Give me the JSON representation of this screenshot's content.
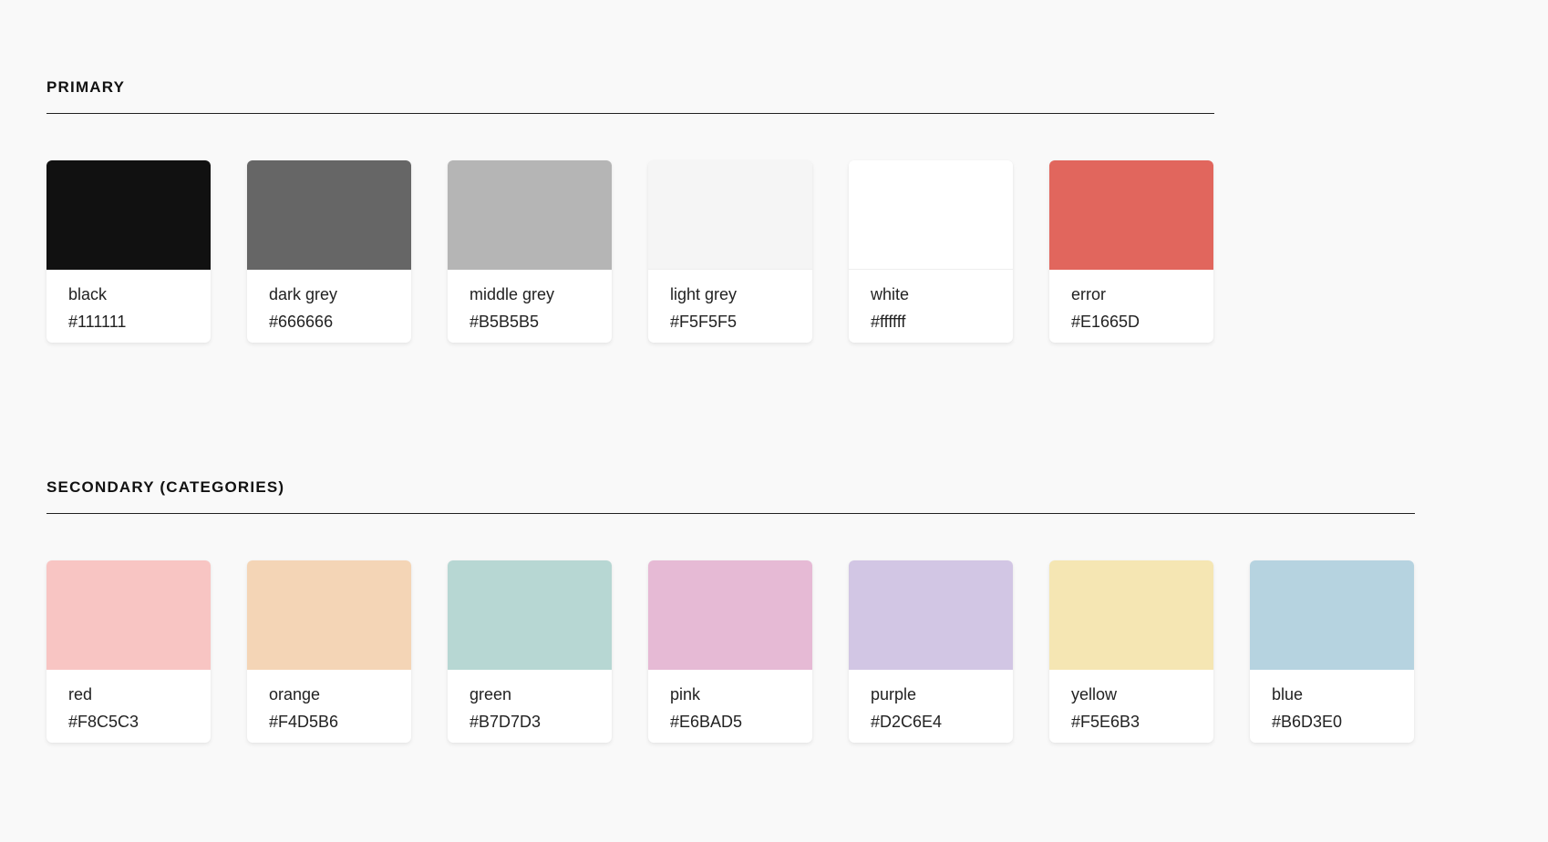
{
  "sections": [
    {
      "title": "PRIMARY",
      "swatches": [
        {
          "name": "black",
          "hex": "#111111",
          "color": "#111111"
        },
        {
          "name": "dark grey",
          "hex": "#666666",
          "color": "#666666"
        },
        {
          "name": "middle grey",
          "hex": "#B5B5B5",
          "color": "#B5B5B5"
        },
        {
          "name": "light grey",
          "hex": "#F5F5F5",
          "color": "#F5F5F5"
        },
        {
          "name": "white",
          "hex": "#ffffff",
          "color": "#ffffff"
        },
        {
          "name": "error",
          "hex": "#E1665D",
          "color": "#E1665D"
        }
      ]
    },
    {
      "title": "SECONDARY (CATEGORIES)",
      "swatches": [
        {
          "name": "red",
          "hex": "#F8C5C3",
          "color": "#F8C5C3"
        },
        {
          "name": "orange",
          "hex": "#F4D5B6",
          "color": "#F4D5B6"
        },
        {
          "name": "green",
          "hex": "#B7D7D3",
          "color": "#B7D7D3"
        },
        {
          "name": "pink",
          "hex": "#E6BAD5",
          "color": "#E6BAD5"
        },
        {
          "name": "purple",
          "hex": "#D2C6E4",
          "color": "#D2C6E4"
        },
        {
          "name": "yellow",
          "hex": "#F5E6B3",
          "color": "#F5E6B3"
        },
        {
          "name": "blue",
          "hex": "#B6D3E0",
          "color": "#B6D3E0"
        }
      ]
    }
  ]
}
